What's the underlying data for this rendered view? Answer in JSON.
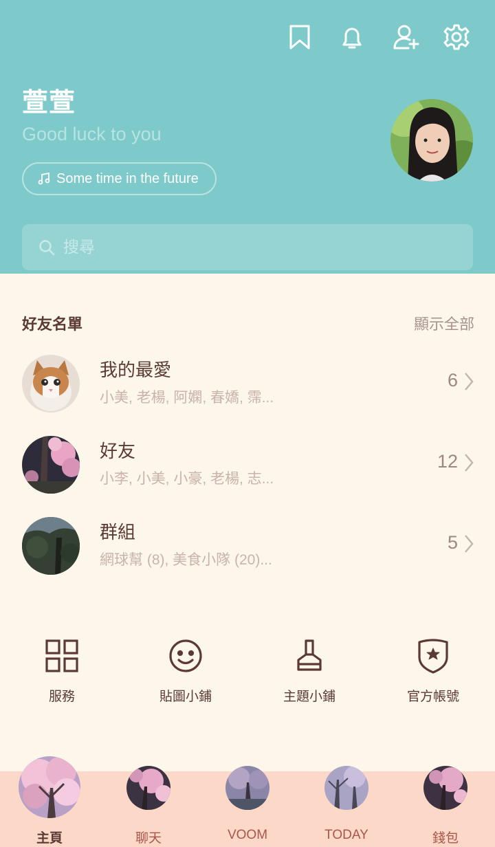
{
  "header": {
    "name": "萱萱",
    "status": "Good luck to you",
    "music": "Some time in the future",
    "search_placeholder": "搜尋",
    "icons": [
      "bookmark-icon",
      "bell-icon",
      "add-friend-icon",
      "gear-icon"
    ]
  },
  "friends": {
    "title": "好友名單",
    "show_all": "顯示全部",
    "rows": [
      {
        "title": "我的最愛",
        "subtitle": "小美, 老楊, 阿嫻, 春嬌, 霈...",
        "count": "6"
      },
      {
        "title": "好友",
        "subtitle": "小李, 小美, 小豪, 老楊, 志...",
        "count": "12"
      },
      {
        "title": "群組",
        "subtitle": "網球幫 (8), 美食小隊 (20)...",
        "count": "5"
      }
    ]
  },
  "shortcuts": [
    {
      "label": "服務",
      "icon": "grid-icon"
    },
    {
      "label": "貼圖小鋪",
      "icon": "smiley-icon"
    },
    {
      "label": "主題小鋪",
      "icon": "brush-icon"
    },
    {
      "label": "官方帳號",
      "icon": "shield-star-icon"
    }
  ],
  "nav": [
    {
      "label": "主頁",
      "active": true
    },
    {
      "label": "聊天"
    },
    {
      "label": "VOOM"
    },
    {
      "label": "TODAY"
    },
    {
      "label": "錢包"
    }
  ],
  "colors": {
    "header_bg": "#7ecacb",
    "page_bg": "#fdf6ea",
    "nav_bg": "#fbd8c8",
    "text_dark": "#5b3a36",
    "nav_text": "#a8564a"
  }
}
